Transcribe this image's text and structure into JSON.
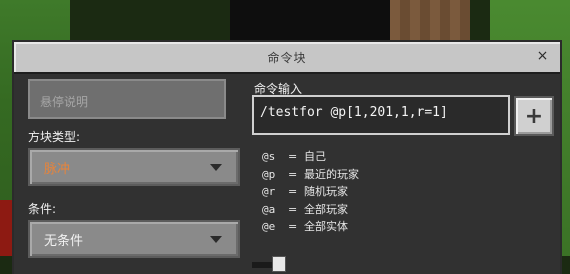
{
  "dialog": {
    "title": "命令块",
    "close_icon": "close-icon"
  },
  "left": {
    "description_placeholder": "悬停说明",
    "block_type_label": "方块类型:",
    "block_type_value": "脉冲",
    "block_type_color": "#e8843a",
    "condition_label": "条件:",
    "condition_value": "无条件",
    "condition_color": "#f2f2f2"
  },
  "right": {
    "command_label": "命令输入",
    "command_value": "/testfor @p[1,201,1,r=1]",
    "plus_label": "+",
    "help": [
      {
        "sel": "@s",
        "eq": "=",
        "desc": "自己"
      },
      {
        "sel": "@p",
        "eq": "=",
        "desc": "最近的玩家"
      },
      {
        "sel": "@r",
        "eq": "=",
        "desc": "随机玩家"
      },
      {
        "sel": "@a",
        "eq": "=",
        "desc": "全部玩家"
      },
      {
        "sel": "@e",
        "eq": "=",
        "desc": "全部实体"
      }
    ]
  }
}
